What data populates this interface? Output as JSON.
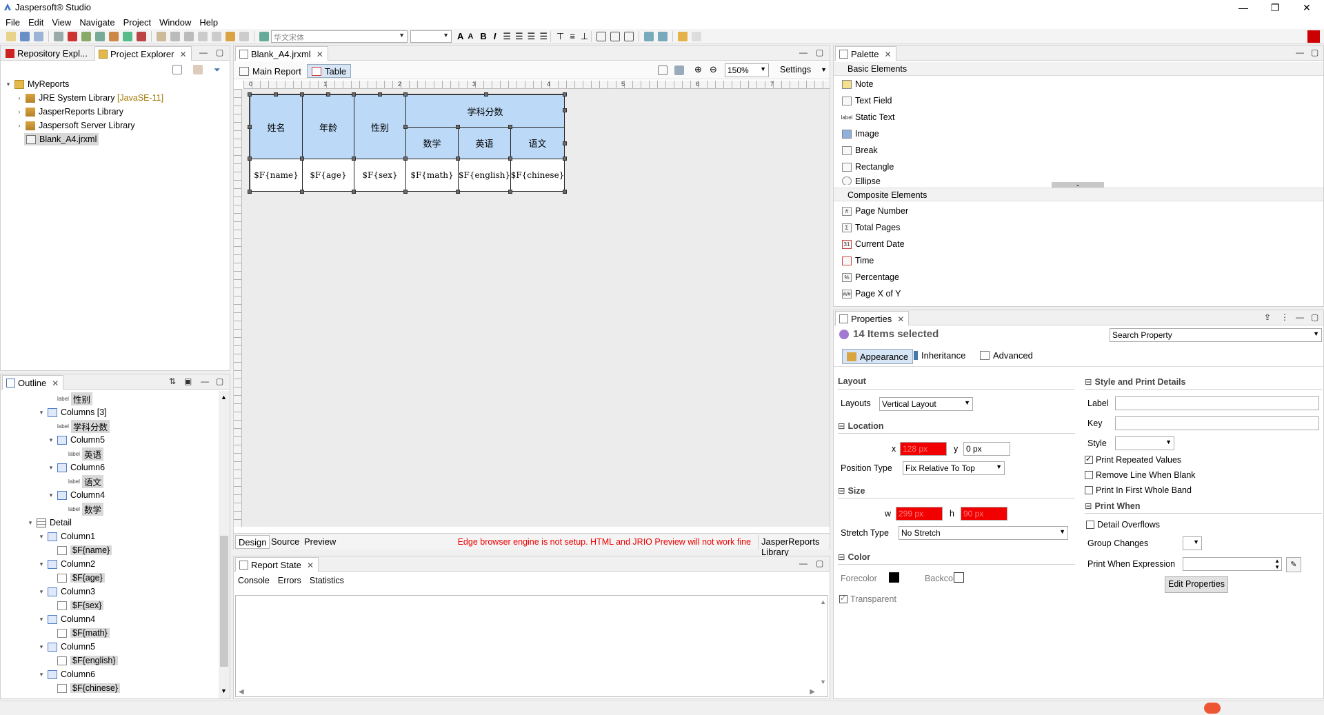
{
  "window": {
    "title": "Jaspersoft® Studio"
  },
  "menu": [
    "File",
    "Edit",
    "View",
    "Navigate",
    "Project",
    "Window",
    "Help"
  ],
  "toolbar": {
    "font_name": "华文宋体",
    "font_size": ""
  },
  "repo_tabs": [
    {
      "label": "Repository Expl..."
    },
    {
      "label": "Project Explorer"
    }
  ],
  "tree": {
    "root": "MyReports",
    "items": [
      {
        "label": "JRE System Library",
        "suffix": "[JavaSE-11]"
      },
      {
        "label": "JasperReports Library",
        "suffix": ""
      },
      {
        "label": "Jaspersoft Server Library",
        "suffix": ""
      },
      {
        "label": "Blank_A4.jrxml",
        "suffix": ""
      }
    ]
  },
  "outline": {
    "tab": "Outline",
    "rows": [
      {
        "text": "性别",
        "tag": "label"
      },
      {
        "text": "Columns [3]",
        "tag": "table"
      },
      {
        "text": "学科分数",
        "tag": "label"
      },
      {
        "text": "Column5",
        "tag": "col"
      },
      {
        "text": "英语",
        "tag": "label"
      },
      {
        "text": "Column6",
        "tag": "col"
      },
      {
        "text": "语文",
        "tag": "label"
      },
      {
        "text": "Column4",
        "tag": "col"
      },
      {
        "text": "数学",
        "tag": "label"
      },
      {
        "text": "Detail",
        "tag": "band"
      },
      {
        "text": "Column1",
        "tag": "col"
      },
      {
        "text": "$F{name}",
        "tag": "field"
      },
      {
        "text": "Column2",
        "tag": "col"
      },
      {
        "text": "$F{age}",
        "tag": "field"
      },
      {
        "text": "Column3",
        "tag": "col"
      },
      {
        "text": "$F{sex}",
        "tag": "field"
      },
      {
        "text": "Column4",
        "tag": "col"
      },
      {
        "text": "$F{math}",
        "tag": "field"
      },
      {
        "text": "Column5",
        "tag": "col"
      },
      {
        "text": "$F{english}",
        "tag": "field"
      },
      {
        "text": "Column6",
        "tag": "col"
      },
      {
        "text": "$F{chinese}",
        "tag": "field"
      }
    ]
  },
  "editor": {
    "file_tab": "Blank_A4.jrxml",
    "subtabs": [
      "Main Report",
      "Table"
    ],
    "zoom": "150%",
    "settings": "Settings",
    "ruler_marks": [
      "0",
      "1",
      "2",
      "3",
      "4",
      "5",
      "6",
      "7"
    ],
    "table": {
      "headers": [
        "姓名",
        "年龄",
        "性别"
      ],
      "group_header": "学科分数",
      "subheaders": [
        "数学",
        "英语",
        "语文"
      ],
      "details": [
        "$F{name}",
        "$F{age}",
        "$F{sex}",
        "$F{math}",
        "$F{english}",
        "$F{chinese}"
      ]
    },
    "bottom_tabs": [
      "Design",
      "Source",
      "Preview"
    ],
    "warning": "Edge browser engine is not setup. HTML and JRIO Preview will not work fine",
    "lib_tab": "JasperReports Library"
  },
  "report_state": {
    "tab": "Report State",
    "subtabs": [
      "Console",
      "Errors",
      "Statistics"
    ]
  },
  "palette": {
    "tab": "Palette",
    "basic_title": "Basic Elements",
    "basic": [
      "Note",
      "Text Field",
      "Static Text",
      "Image",
      "Break",
      "Rectangle",
      "Ellipse"
    ],
    "composite_title": "Composite Elements",
    "composite": [
      "Page Number",
      "Total Pages",
      "Current Date",
      "Time",
      "Percentage",
      "Page X of Y"
    ]
  },
  "properties": {
    "tab": "Properties",
    "selected": "14 Items selected",
    "search_placeholder": "Search Property",
    "subtabs": [
      "Appearance",
      "Inheritance",
      "Advanced"
    ],
    "layout_group": "Layout",
    "layouts_label": "Layouts",
    "layouts_value": "Vertical Layout",
    "location_group": "Location",
    "x_label": "x",
    "x_value": "128 px",
    "y_label": "y",
    "y_value": "0 px",
    "position_type_label": "Position Type",
    "position_type_value": "Fix Relative To Top",
    "size_group": "Size",
    "w_label": "w",
    "w_value": "299 px",
    "h_label": "h",
    "h_value": "90 px",
    "stretch_label": "Stretch Type",
    "stretch_value": "No Stretch",
    "color_group": "Color",
    "forecolor": "Forecolor",
    "backcolor": "Backcolor",
    "transparent": "Transparent",
    "style_group": "Style and Print Details",
    "label_label": "Label",
    "key_label": "Key",
    "style_label": "Style",
    "print_repeated": "Print Repeated Values",
    "remove_line": "Remove Line When Blank",
    "print_first": "Print In First Whole Band",
    "print_when_group": "Print When",
    "detail_overflows": "Detail Overflows",
    "group_changes": "Group Changes",
    "print_when_expr": "Print When Expression",
    "edit_props": "Edit Properties"
  },
  "colors": {
    "header_fill": "#bcd9f7",
    "error_red": "#f20000",
    "accent": "#cc0000"
  }
}
